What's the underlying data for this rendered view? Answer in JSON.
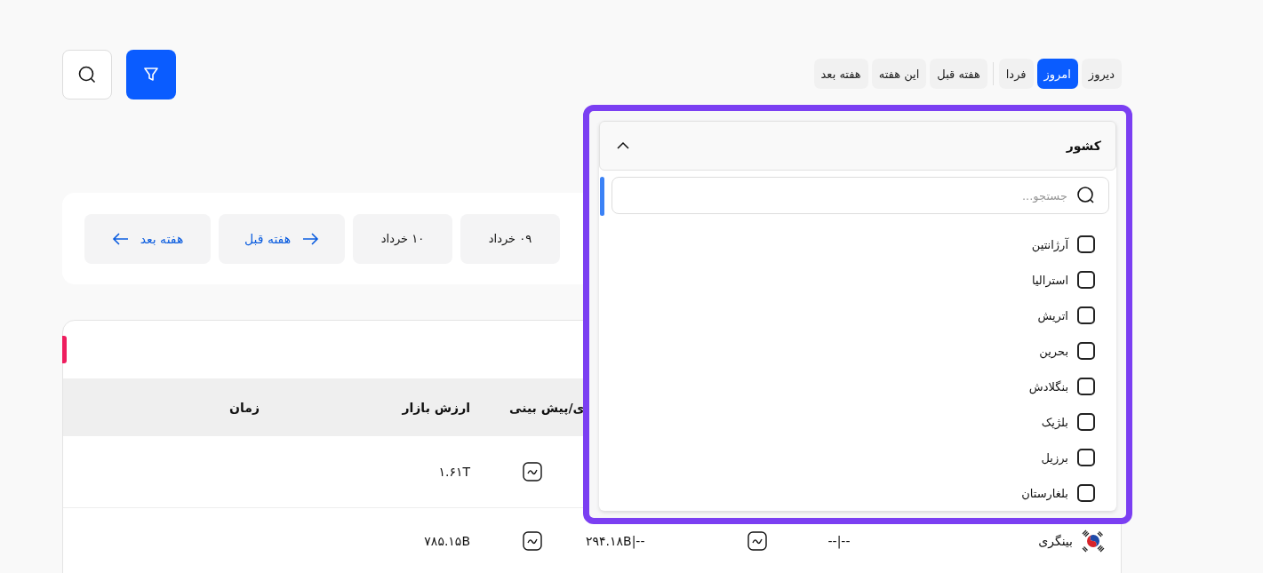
{
  "tab_groups": [
    {
      "tabs": [
        {
          "label": "دیروز",
          "selected": false
        },
        {
          "label": "امروز",
          "selected": true
        },
        {
          "label": "فردا",
          "selected": false
        }
      ]
    },
    {
      "tabs": [
        {
          "label": "هفته قبل",
          "selected": false
        },
        {
          "label": "این هفته",
          "selected": false
        },
        {
          "label": "هفته بعد",
          "selected": false
        }
      ]
    }
  ],
  "date_nav": [
    {
      "kind": "date",
      "label": "۰۹ خرداد"
    },
    {
      "kind": "date",
      "label": "۱۰ خرداد"
    },
    {
      "kind": "prev",
      "label": "هفته قبل"
    },
    {
      "kind": "next",
      "label": "هفته بعد"
    }
  ],
  "table": {
    "columns": [
      {
        "label": "ی/پیش بینی"
      },
      {
        "label": "ارزش بازار"
      },
      {
        "label": "زمان"
      }
    ],
    "rows": [
      {
        "market_value": "۱.۶۱T"
      },
      {
        "country": "بینگری",
        "actual": "--|--",
        "forecast": "--|۲۹۴.۱۸B",
        "market_value": "۷۸۵.۱۵B"
      }
    ]
  },
  "country_filter": {
    "title": "کشور",
    "expanded": true,
    "search": {
      "placeholder": "جستجو..."
    },
    "options": [
      {
        "label": "آرژانتین",
        "checked": false
      },
      {
        "label": "استرالیا",
        "checked": false
      },
      {
        "label": "اتریش",
        "checked": false
      },
      {
        "label": "بحرین",
        "checked": false
      },
      {
        "label": "بنگلادش",
        "checked": false
      },
      {
        "label": "بلژیک",
        "checked": false
      },
      {
        "label": "برزیل",
        "checked": false
      },
      {
        "label": "بلغارستان",
        "checked": false
      }
    ]
  }
}
